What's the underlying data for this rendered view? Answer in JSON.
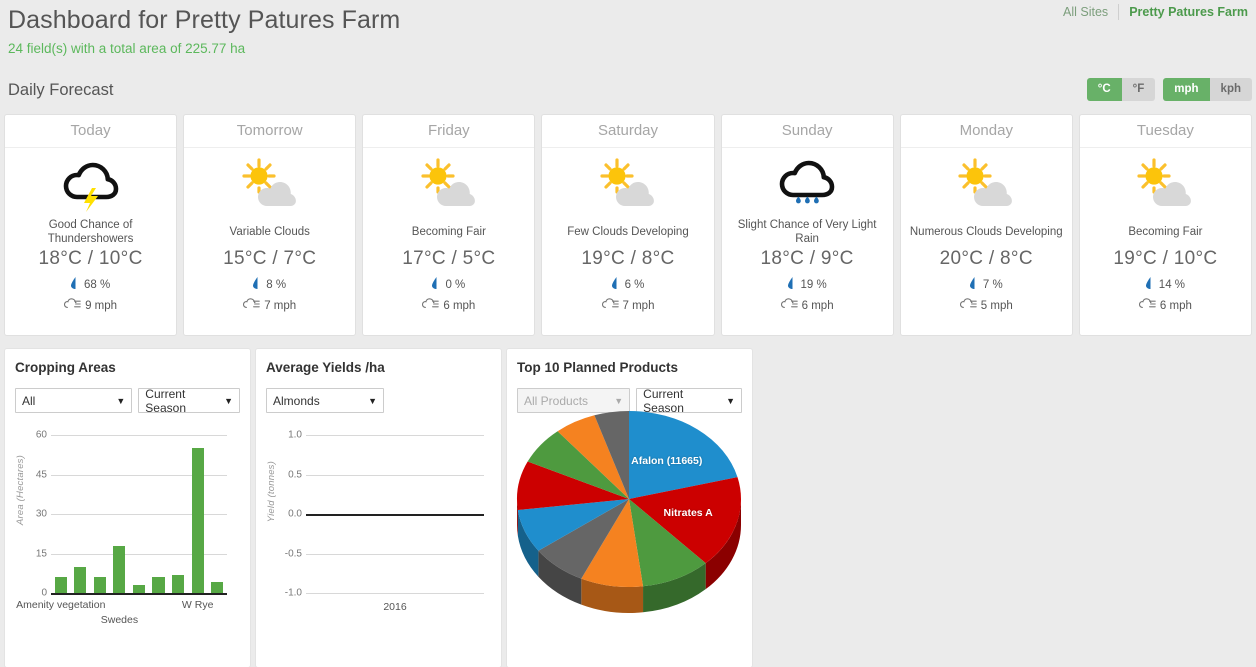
{
  "header": {
    "title": "Dashboard for Pretty Patures Farm",
    "subtitle": "24 field(s) with a total area of 225.77 ha",
    "nav": {
      "all_sites": "All Sites",
      "current_site": "Pretty Patures Farm"
    }
  },
  "forecast": {
    "section_label": "Daily Forecast",
    "units": {
      "temperature": [
        {
          "label": "°C",
          "active": true
        },
        {
          "label": "°F",
          "active": false
        }
      ],
      "speed": [
        {
          "label": "mph",
          "active": true
        },
        {
          "label": "kph",
          "active": false
        }
      ]
    },
    "days": [
      {
        "day": "Today",
        "icon": "thunderstorm-icon",
        "condition": "Good Chance of Thundershowers",
        "temp": "18°C / 10°C",
        "precip": "68 %",
        "wind": "9 mph"
      },
      {
        "day": "Tomorrow",
        "icon": "sun-cloud-icon",
        "condition": "Variable Clouds",
        "temp": "15°C / 7°C",
        "precip": "8 %",
        "wind": "7 mph"
      },
      {
        "day": "Friday",
        "icon": "sun-cloud-icon",
        "condition": "Becoming Fair",
        "temp": "17°C / 5°C",
        "precip": "0 %",
        "wind": "6 mph"
      },
      {
        "day": "Saturday",
        "icon": "sun-cloud-icon",
        "condition": "Few Clouds Developing",
        "temp": "19°C / 8°C",
        "precip": "6 %",
        "wind": "7 mph"
      },
      {
        "day": "Sunday",
        "icon": "rain-cloud-icon",
        "condition": "Slight Chance of Very Light Rain",
        "temp": "18°C / 9°C",
        "precip": "19 %",
        "wind": "6 mph"
      },
      {
        "day": "Monday",
        "icon": "sun-cloud-icon",
        "condition": "Numerous Clouds Developing",
        "temp": "20°C / 8°C",
        "precip": "7 %",
        "wind": "5 mph"
      },
      {
        "day": "Tuesday",
        "icon": "sun-cloud-icon",
        "condition": "Becoming Fair",
        "temp": "19°C / 10°C",
        "precip": "14 %",
        "wind": "6 mph"
      }
    ]
  },
  "panels": {
    "cropping": {
      "title": "Cropping Areas",
      "filter_crop": "All",
      "filter_season": "Current Season"
    },
    "yields": {
      "title": "Average Yields /ha",
      "filter_crop": "Almonds"
    },
    "products": {
      "title": "Top 10 Planned Products",
      "filter_product": "All Products",
      "filter_season": "Current Season"
    }
  },
  "chart_data": [
    {
      "type": "bar",
      "title": "Cropping Areas",
      "xlabel": "",
      "ylabel": "Area (Hectares)",
      "ylim": [
        0,
        60
      ],
      "yticks": [
        0,
        15,
        30,
        45,
        60
      ],
      "grid": true,
      "categories": [
        "Amenity vegetation",
        "",
        "",
        "Swedes",
        "",
        "",
        "",
        "W Rye",
        ""
      ],
      "visible_tick_labels": [
        "Amenity vegetation",
        "Swedes",
        "W Rye"
      ],
      "values": [
        6,
        10,
        6,
        18,
        3,
        6,
        6.7,
        55,
        4
      ],
      "bar_color": "#57a845"
    },
    {
      "type": "line",
      "title": "Average Yields /ha",
      "xlabel": "",
      "ylabel": "Yield (tonnes)",
      "ylim": [
        -1.0,
        1.0
      ],
      "yticks": [
        "1.0",
        "0.5",
        "0.0",
        "-0.5",
        "-1.0"
      ],
      "grid": true,
      "categories": [
        "2016"
      ],
      "values": [],
      "note": "no data plotted"
    },
    {
      "type": "pie",
      "title": "Top 10 Planned Products",
      "legend": "none",
      "labels": [
        "Afalon (11665)",
        "Nitrates A",
        "slice-3",
        "slice-4",
        "slice-5",
        "slice-6",
        "slice-7",
        "slice-8",
        "slice-9",
        "slice-10"
      ],
      "visible_labels": [
        "Afalon (11665)",
        "Nitrates A"
      ],
      "values": [
        21,
        17,
        10,
        9,
        8,
        8,
        9,
        7,
        6,
        5
      ],
      "colors": [
        "#1f8ecd",
        "#cc0000",
        "#4e9a3f",
        "#f58220",
        "#666666",
        "#1f8ecd",
        "#cc0000",
        "#4e9a3f",
        "#f58220",
        "#666666"
      ]
    }
  ]
}
